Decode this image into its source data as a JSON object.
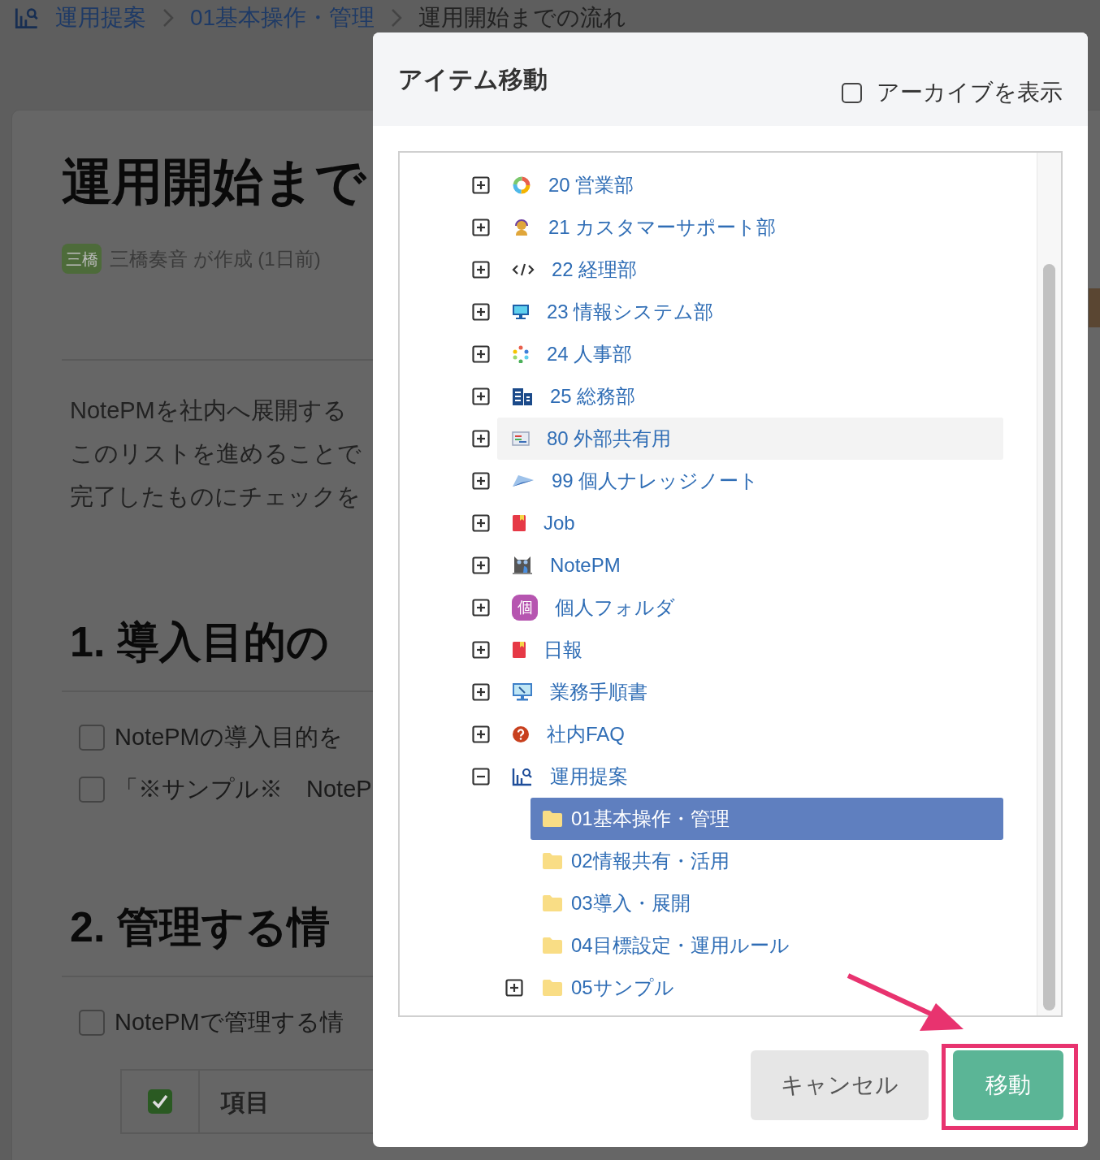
{
  "breadcrumb": [
    {
      "label": "運用提案"
    },
    {
      "label": "01基本操作・管理"
    },
    {
      "label": "運用開始までの流れ"
    }
  ],
  "page": {
    "title": "運用開始まで",
    "author_badge": "三橋",
    "meta": "三橋奏音 が作成 (1日前)",
    "intro": [
      "NotePMを社内へ展開する",
      "このリストを進めることで",
      "完了したものにチェックを"
    ],
    "sections": [
      {
        "heading": "1. 導入目的の",
        "tasks": [
          {
            "text": "NotePMの導入目的を",
            "checked": false
          },
          {
            "text": "「※サンプル※　NoteP",
            "checked": false
          }
        ]
      },
      {
        "heading": "2. 管理する情",
        "tasks": [
          {
            "text": "NotePMで管理する情",
            "checked": false
          }
        ]
      }
    ],
    "table": {
      "header": "項目"
    }
  },
  "dialog": {
    "title": "アイテム移動",
    "show_archive": {
      "label": "アーカイブを表示",
      "checked": false
    },
    "tree": [
      {
        "label": "20 営業部",
        "kind": "collapsed",
        "selected": false,
        "hovered": false
      },
      {
        "label": "21 カスタマーサポート部",
        "kind": "collapsed",
        "selected": false,
        "hovered": false
      },
      {
        "label": "22 経理部",
        "kind": "collapsed",
        "selected": false,
        "hovered": false
      },
      {
        "label": "23 情報システム部",
        "kind": "collapsed",
        "selected": false,
        "hovered": false
      },
      {
        "label": "24 人事部",
        "kind": "collapsed",
        "selected": false,
        "hovered": false
      },
      {
        "label": "25 総務部",
        "kind": "collapsed",
        "selected": false,
        "hovered": false
      },
      {
        "label": "80 外部共有用",
        "kind": "collapsed",
        "selected": false,
        "hovered": true
      },
      {
        "label": "99 個人ナレッジノート",
        "kind": "collapsed",
        "selected": false,
        "hovered": false
      },
      {
        "label": "Job",
        "kind": "collapsed",
        "selected": false,
        "hovered": false
      },
      {
        "label": "NotePM",
        "kind": "collapsed",
        "selected": false,
        "hovered": false
      },
      {
        "label": "個人フォルダ",
        "kind": "collapsed",
        "selected": false,
        "hovered": false,
        "badge": "個"
      },
      {
        "label": "日報",
        "kind": "collapsed",
        "selected": false,
        "hovered": false
      },
      {
        "label": "業務手順書",
        "kind": "collapsed",
        "selected": false,
        "hovered": false
      },
      {
        "label": "社内FAQ",
        "kind": "collapsed",
        "selected": false,
        "hovered": false
      },
      {
        "label": "運用提案",
        "kind": "expanded",
        "selected": false,
        "hovered": false,
        "children": [
          {
            "label": "01基本操作・管理",
            "kind": "leaf",
            "selected": true
          },
          {
            "label": "02情報共有・活用",
            "kind": "leaf",
            "selected": false
          },
          {
            "label": "03導入・展開",
            "kind": "leaf",
            "selected": false
          },
          {
            "label": "04目標設定・運用ルール",
            "kind": "leaf",
            "selected": false
          },
          {
            "label": "05サンプル",
            "kind": "collapsed",
            "selected": false
          }
        ]
      }
    ],
    "buttons": [
      {
        "label": "キャンセル",
        "kind": "secondary"
      },
      {
        "label": "移動",
        "kind": "primary"
      }
    ]
  }
}
